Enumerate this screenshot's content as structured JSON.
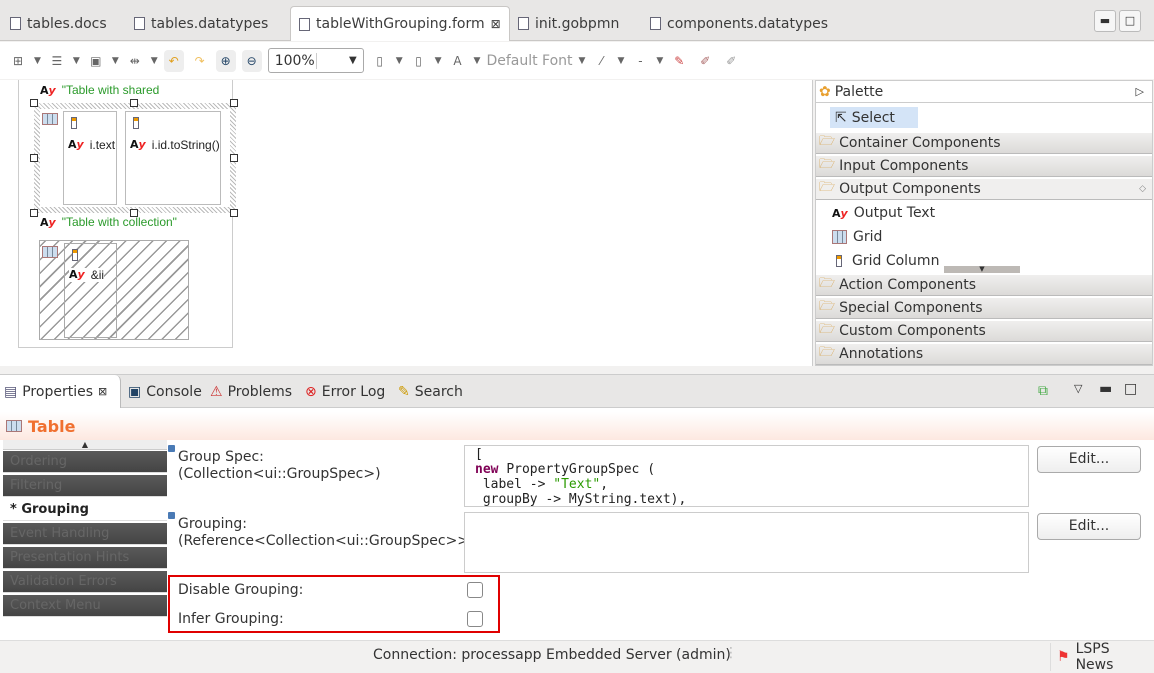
{
  "editor_tabs": [
    {
      "label": "tables.docs"
    },
    {
      "label": "tables.datatypes"
    },
    {
      "label": "tableWithGrouping.form",
      "active": true,
      "close": "⊠"
    },
    {
      "label": "init.gobpmn"
    },
    {
      "label": "components.datatypes"
    }
  ],
  "toolbar": {
    "zoom": "100%",
    "font": "Default Font",
    "font_color_label": "A",
    "line_label": "-"
  },
  "canvas": {
    "label1": "\"Table with shared",
    "col1": "i.text",
    "col2": "i.id.toString()",
    "label2": "\"Table with collection\"",
    "col3": "&ii",
    "ay_a": "A",
    "ay_y": "y"
  },
  "palette": {
    "title": "Palette",
    "select": "Select",
    "drawers": [
      "Container Components",
      "Input Components",
      "Output Components",
      "Action Components",
      "Special Components",
      "Custom Components",
      "Annotations"
    ],
    "output_items": [
      "Output Text",
      "Grid",
      "Grid Column"
    ]
  },
  "panel_tabs": [
    {
      "label": "Properties",
      "active": true,
      "close": "⊠"
    },
    {
      "label": "Console"
    },
    {
      "label": "Problems"
    },
    {
      "label": "Error Log"
    },
    {
      "label": "Search"
    }
  ],
  "properties": {
    "title": "Table",
    "title_color": "#f07030",
    "sections": [
      "Ordering",
      "Filtering",
      "* Grouping",
      "Event Handling",
      "Presentation Hints",
      "Validation Errors",
      "Context Menu"
    ],
    "group_spec_label": "Group Spec:",
    "group_spec_type": "(Collection<ui::GroupSpec>)",
    "code_lines": [
      "[",
      "new PropertyGroupSpec (",
      "label -> \"Text\",",
      "groupBy -> MyString.text),"
    ],
    "grouping_label": "Grouping:",
    "grouping_type": "(Reference<Collection<ui::GroupSpec>>)",
    "edit_label": "Edit...",
    "disable_grouping": "Disable Grouping:",
    "infer_grouping": "Infer Grouping:",
    "disable_grouping_checked": false,
    "infer_grouping_checked": false,
    "highlight_color": "#e00000"
  },
  "status": {
    "connection": "Connection: processapp Embedded Server (admin)",
    "news": "LSPS News"
  }
}
